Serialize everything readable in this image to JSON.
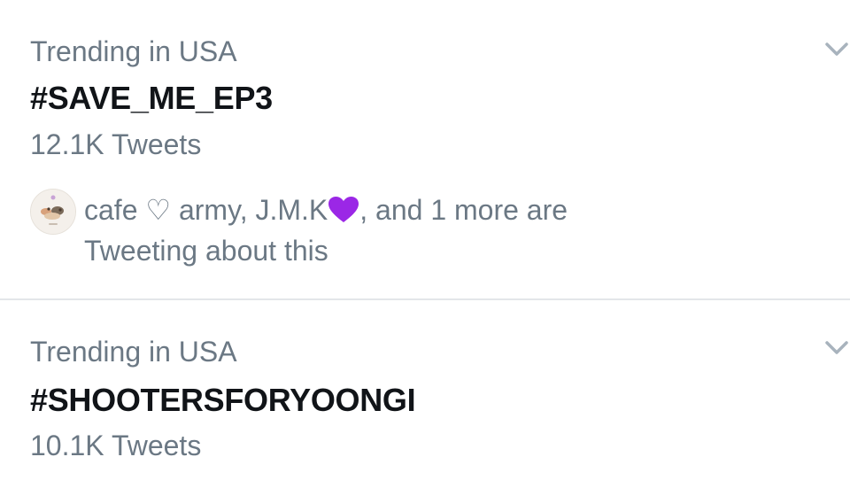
{
  "trends": [
    {
      "context": "Trending in USA",
      "hashtag": "#SAVE_ME_EP3",
      "count": "12.1K Tweets",
      "social": {
        "names_before_heart": "cafe ♡ army, J.M.K",
        "after_heart": ", and 1 more are",
        "line2": "Tweeting about this",
        "heart_color": "#9b27e6",
        "avatar_icon": "avatar-icon"
      }
    },
    {
      "context": "Trending in USA",
      "hashtag": "#SHOOTERSFORYOONGI",
      "count": "10.1K Tweets"
    }
  ],
  "colors": {
    "secondary_text": "#6b7884",
    "primary_text": "#111418",
    "divider": "#e3e6e9",
    "chevron": "#a8b3bd"
  },
  "icons": {
    "menu": "chevron-down-icon",
    "heart": "purple-heart-icon"
  }
}
